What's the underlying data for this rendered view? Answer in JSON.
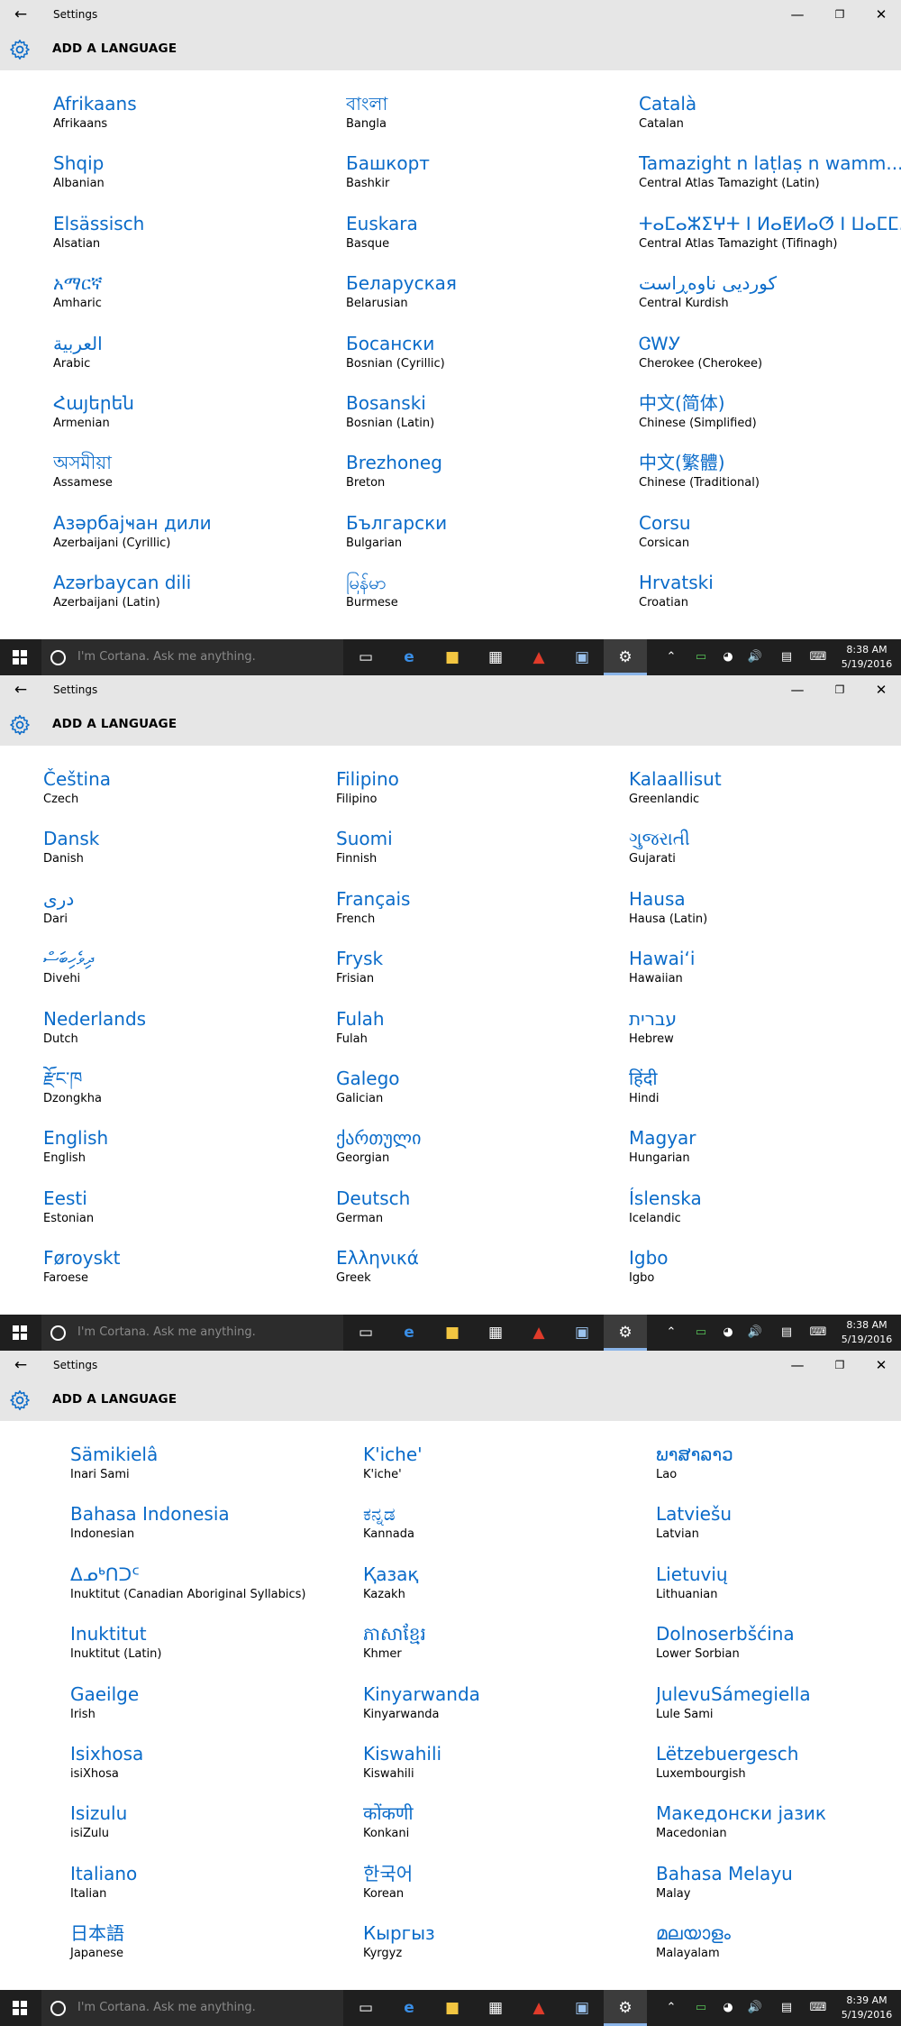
{
  "window": {
    "title": "Settings",
    "header_title": "ADD A LANGUAGE"
  },
  "taskbar": {
    "search_placeholder": "I'm Cortana. Ask me anything."
  },
  "screens": [
    {
      "clock_time": "8:38 AM",
      "clock_date": "5/19/2016",
      "columns": [
        [
          {
            "native": "Afrikaans",
            "english": "Afrikaans"
          },
          {
            "native": "Shqip",
            "english": "Albanian"
          },
          {
            "native": "Elsässisch",
            "english": "Alsatian"
          },
          {
            "native": "አማርኛ",
            "english": "Amharic"
          },
          {
            "native": "العربية",
            "english": "Arabic"
          },
          {
            "native": "Հայերեն",
            "english": "Armenian"
          },
          {
            "native": "অসমীয়া",
            "english": "Assamese"
          },
          {
            "native": "Азәрбајҹан дили",
            "english": "Azerbaijani (Cyrillic)"
          },
          {
            "native": "Azərbaycan dili",
            "english": "Azerbaijani (Latin)"
          }
        ],
        [
          {
            "native": "বাংলা",
            "english": "Bangla"
          },
          {
            "native": "Башкорт",
            "english": "Bashkir"
          },
          {
            "native": "Euskara",
            "english": "Basque"
          },
          {
            "native": "Беларуская",
            "english": "Belarusian"
          },
          {
            "native": "Босански",
            "english": "Bosnian (Cyrillic)"
          },
          {
            "native": "Bosanski",
            "english": "Bosnian (Latin)"
          },
          {
            "native": "Brezhoneg",
            "english": "Breton"
          },
          {
            "native": "Български",
            "english": "Bulgarian"
          },
          {
            "native": "မြန်မာ",
            "english": "Burmese"
          }
        ],
        [
          {
            "native": "Català",
            "english": "Catalan"
          },
          {
            "native": "Tamazight n laṭlaṣ n wamm...",
            "english": "Central Atlas Tamazight (Latin)"
          },
          {
            "native": "ⵜⴰⵎⴰⵣⵉⵖⵜ ⵏ ⵍⴰⵟⵍⴰⵚ ⵏ ⵡⴰⵎⵎⴰⵙ",
            "english": "Central Atlas Tamazight (Tifinagh)"
          },
          {
            "native": "کوردیی ناوەڕاست",
            "english": "Central Kurdish"
          },
          {
            "native": "ᏣᎳᎩ",
            "english": "Cherokee (Cherokee)"
          },
          {
            "native": "中文(简体)",
            "english": "Chinese (Simplified)"
          },
          {
            "native": "中文(繁體)",
            "english": "Chinese (Traditional)"
          },
          {
            "native": "Corsu",
            "english": "Corsican"
          },
          {
            "native": "Hrvatski",
            "english": "Croatian"
          }
        ]
      ]
    },
    {
      "clock_time": "8:38 AM",
      "clock_date": "5/19/2016",
      "columns": [
        [
          {
            "native": "Čeština",
            "english": "Czech"
          },
          {
            "native": "Dansk",
            "english": "Danish"
          },
          {
            "native": "دری",
            "english": "Dari"
          },
          {
            "native": "ދިވެހިބަސް",
            "english": "Divehi"
          },
          {
            "native": "Nederlands",
            "english": "Dutch"
          },
          {
            "native": "རྫོང་ཁ",
            "english": "Dzongkha"
          },
          {
            "native": "English",
            "english": "English"
          },
          {
            "native": "Eesti",
            "english": "Estonian"
          },
          {
            "native": "Føroyskt",
            "english": "Faroese"
          }
        ],
        [
          {
            "native": "Filipino",
            "english": "Filipino"
          },
          {
            "native": "Suomi",
            "english": "Finnish"
          },
          {
            "native": "Français",
            "english": "French"
          },
          {
            "native": "Frysk",
            "english": "Frisian"
          },
          {
            "native": "Fulah",
            "english": "Fulah"
          },
          {
            "native": "Galego",
            "english": "Galician"
          },
          {
            "native": "ქართული",
            "english": "Georgian"
          },
          {
            "native": "Deutsch",
            "english": "German"
          },
          {
            "native": "Ελληνικά",
            "english": "Greek"
          }
        ],
        [
          {
            "native": "Kalaallisut",
            "english": "Greenlandic"
          },
          {
            "native": "ગુજરાતી",
            "english": "Gujarati"
          },
          {
            "native": "Hausa",
            "english": "Hausa (Latin)"
          },
          {
            "native": "Hawaiʻi",
            "english": "Hawaiian"
          },
          {
            "native": "עברית",
            "english": "Hebrew"
          },
          {
            "native": "हिंदी",
            "english": "Hindi"
          },
          {
            "native": "Magyar",
            "english": "Hungarian"
          },
          {
            "native": "Íslenska",
            "english": "Icelandic"
          },
          {
            "native": "Igbo",
            "english": "Igbo"
          }
        ]
      ]
    },
    {
      "clock_time": "8:39 AM",
      "clock_date": "5/19/2016",
      "columns": [
        [
          {
            "native": "Sämikielâ",
            "english": "Inari Sami"
          },
          {
            "native": "Bahasa Indonesia",
            "english": "Indonesian"
          },
          {
            "native": "ᐃᓄᒃᑎᑐᑦ",
            "english": "Inuktitut (Canadian Aboriginal Syllabics)"
          },
          {
            "native": "Inuktitut",
            "english": "Inuktitut (Latin)"
          },
          {
            "native": "Gaeilge",
            "english": "Irish"
          },
          {
            "native": "Isixhosa",
            "english": "isiXhosa"
          },
          {
            "native": "Isizulu",
            "english": "isiZulu"
          },
          {
            "native": "Italiano",
            "english": "Italian"
          },
          {
            "native": "日本語",
            "english": "Japanese"
          }
        ],
        [
          {
            "native": "K'iche'",
            "english": "K'iche'"
          },
          {
            "native": "ಕನ್ನಡ",
            "english": "Kannada"
          },
          {
            "native": "Қазақ",
            "english": "Kazakh"
          },
          {
            "native": "ភាសាខ្មែរ",
            "english": "Khmer"
          },
          {
            "native": "Kinyarwanda",
            "english": "Kinyarwanda"
          },
          {
            "native": "Kiswahili",
            "english": "Kiswahili"
          },
          {
            "native": "कोंकणी",
            "english": "Konkani"
          },
          {
            "native": "한국어",
            "english": "Korean"
          },
          {
            "native": "Кыргыз",
            "english": "Kyrgyz"
          }
        ],
        [
          {
            "native": "ພາສາລາວ",
            "english": "Lao"
          },
          {
            "native": "Latviešu",
            "english": "Latvian"
          },
          {
            "native": "Lietuvių",
            "english": "Lithuanian"
          },
          {
            "native": "Dolnoserbšćina",
            "english": "Lower Sorbian"
          },
          {
            "native": "JulevuSámegiella",
            "english": "Lule Sami"
          },
          {
            "native": "Lëtzebuergesch",
            "english": "Luxembourgish"
          },
          {
            "native": "Македонски јазик",
            "english": "Macedonian"
          },
          {
            "native": "Bahasa Melayu",
            "english": "Malay"
          },
          {
            "native": "മലയാളം",
            "english": "Malayalam"
          }
        ]
      ]
    }
  ]
}
